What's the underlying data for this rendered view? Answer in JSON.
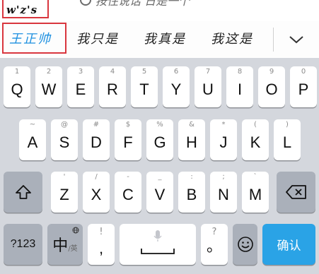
{
  "composition": {
    "typed": "w'z's"
  },
  "top_hint": {
    "text": "按住说话 日是一个"
  },
  "candidates": {
    "items": [
      "王正帅",
      "我只是",
      "我真是",
      "我这是"
    ],
    "expand_icon": "chevron-down-icon",
    "highlight_color": "#1e90e0"
  },
  "keyboard": {
    "row1": [
      {
        "num": "1",
        "letter": "Q"
      },
      {
        "num": "2",
        "letter": "W"
      },
      {
        "num": "3",
        "letter": "E"
      },
      {
        "num": "4",
        "letter": "R"
      },
      {
        "num": "5",
        "letter": "T"
      },
      {
        "num": "6",
        "letter": "Y"
      },
      {
        "num": "7",
        "letter": "U"
      },
      {
        "num": "8",
        "letter": "I"
      },
      {
        "num": "9",
        "letter": "O"
      },
      {
        "num": "0",
        "letter": "P"
      }
    ],
    "row2": [
      {
        "num": "~",
        "letter": "A"
      },
      {
        "num": "@",
        "letter": "S"
      },
      {
        "num": "#",
        "letter": "D"
      },
      {
        "num": "$",
        "letter": "F"
      },
      {
        "num": "%",
        "letter": "G"
      },
      {
        "num": "&",
        "letter": "H"
      },
      {
        "num": "*",
        "letter": "J"
      },
      {
        "num": "(",
        "letter": "K"
      },
      {
        "num": ")",
        "letter": "L"
      }
    ],
    "row3": [
      {
        "num": "'",
        "letter": "Z"
      },
      {
        "num": "/",
        "letter": "X"
      },
      {
        "num": "-",
        "letter": "C"
      },
      {
        "num": "_",
        "letter": "V"
      },
      {
        "num": ":",
        "letter": "B"
      },
      {
        "num": ";",
        "letter": "N"
      },
      {
        "num": "`",
        "letter": "M"
      }
    ],
    "shift_icon": "shift-arrow-icon",
    "backspace_icon": "backspace-icon",
    "numbers_key": "?123",
    "lang_key": {
      "main": "中",
      "sub": "/英",
      "globe_icon": "globe-icon"
    },
    "comma_key": {
      "top": "!",
      "main": ","
    },
    "space_key": {
      "mic_icon": "microphone-icon",
      "space_icon": "space-bar-icon"
    },
    "period_key": {
      "top": "?",
      "main": "。"
    },
    "emoji_icon": "emoji-smile-icon",
    "confirm_key": "确认",
    "colors": {
      "background": "#d4d7dd",
      "key": "#ffffff",
      "function_key": "#aab0ba",
      "confirm": "#2aa3e6"
    }
  }
}
